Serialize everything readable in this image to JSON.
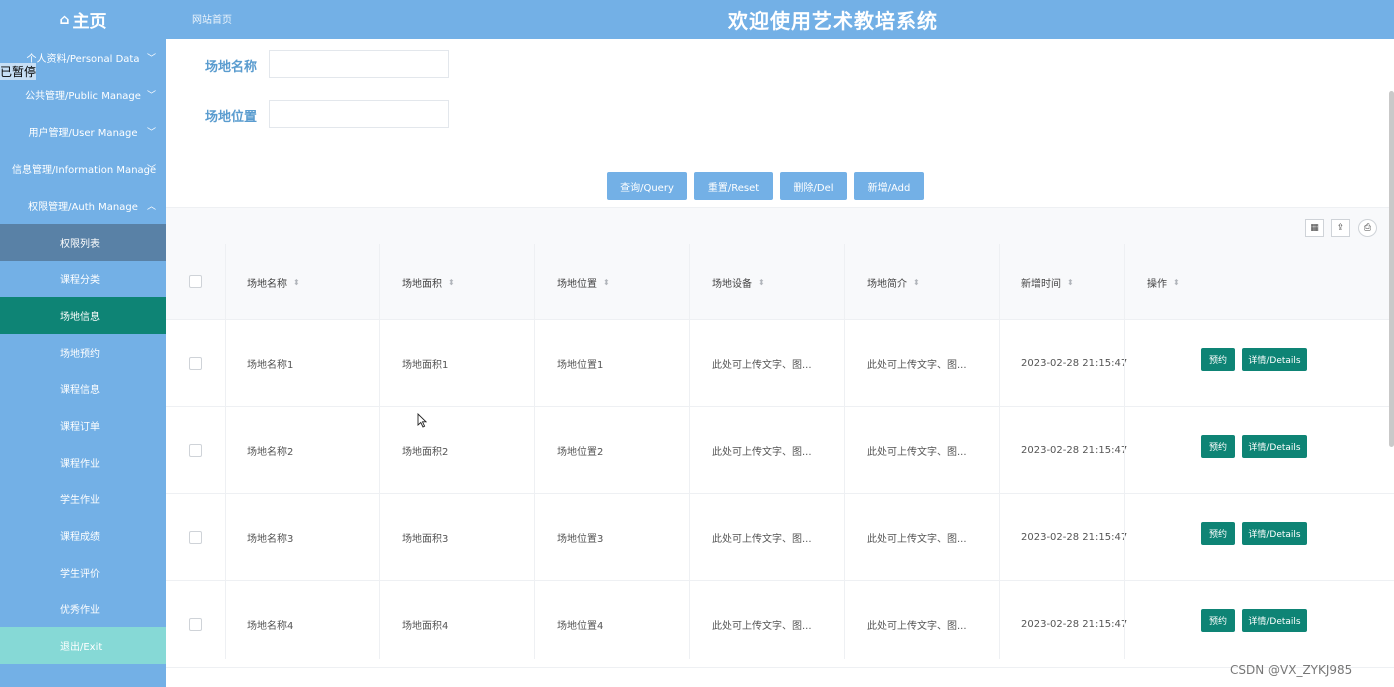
{
  "header": {
    "home_label": "主页",
    "home_icon": "home-icon",
    "breadcrumb": "网站首页",
    "system_title": "欢迎使用艺术教培系统"
  },
  "overlay": {
    "paused_label": "已暂停"
  },
  "sidebar": {
    "groups": [
      {
        "label": "个人资料/Personal Data"
      },
      {
        "label": "公共管理/Public Manage"
      },
      {
        "label": "用户管理/User Manage"
      },
      {
        "label": "信息管理/Information Manage"
      },
      {
        "label": "权限管理/Auth Manage"
      }
    ],
    "sub_items": [
      {
        "label": "权限列表"
      },
      {
        "label": "课程分类"
      },
      {
        "label": "场地信息"
      },
      {
        "label": "场地预约"
      },
      {
        "label": "课程信息"
      },
      {
        "label": "课程订单"
      },
      {
        "label": "课程作业"
      },
      {
        "label": "学生作业"
      },
      {
        "label": "课程成绩"
      },
      {
        "label": "学生评价"
      },
      {
        "label": "优秀作业"
      },
      {
        "label": "退出/Exit"
      }
    ]
  },
  "filters": {
    "name_label": "场地名称",
    "name_value": "",
    "location_label": "场地位置",
    "location_value": ""
  },
  "actions": {
    "query": "查询/Query",
    "reset": "重置/Reset",
    "delete": "删除/Del",
    "add": "新增/Add"
  },
  "table": {
    "columns": [
      "场地名称",
      "场地面积",
      "场地位置",
      "场地设备",
      "场地简介",
      "新增时间",
      "操作"
    ],
    "rows": [
      {
        "name": "场地名称1",
        "area": "场地面积1",
        "location": "场地位置1",
        "equipment": "此处可上传文字、图...",
        "intro": "此处可上传文字、图...",
        "time": "2023-02-28 21:15:47"
      },
      {
        "name": "场地名称2",
        "area": "场地面积2",
        "location": "场地位置2",
        "equipment": "此处可上传文字、图...",
        "intro": "此处可上传文字、图...",
        "time": "2023-02-28 21:15:47"
      },
      {
        "name": "场地名称3",
        "area": "场地面积3",
        "location": "场地位置3",
        "equipment": "此处可上传文字、图...",
        "intro": "此处可上传文字、图...",
        "time": "2023-02-28 21:15:47"
      },
      {
        "name": "场地名称4",
        "area": "场地面积4",
        "location": "场地位置4",
        "equipment": "此处可上传文字、图...",
        "intro": "此处可上传文字、图...",
        "time": "2023-02-28 21:15:47"
      }
    ],
    "row_actions": {
      "book": "预约",
      "details": "详情/Details"
    }
  },
  "watermark": "CSDN @VX_ZYKJ985",
  "colors": {
    "primary_blue": "#73b0e6",
    "teal": "#0e8475",
    "active_dark": "#5981a6",
    "exit_bg": "#86d9d6",
    "label_blue": "#5a9ccf"
  }
}
